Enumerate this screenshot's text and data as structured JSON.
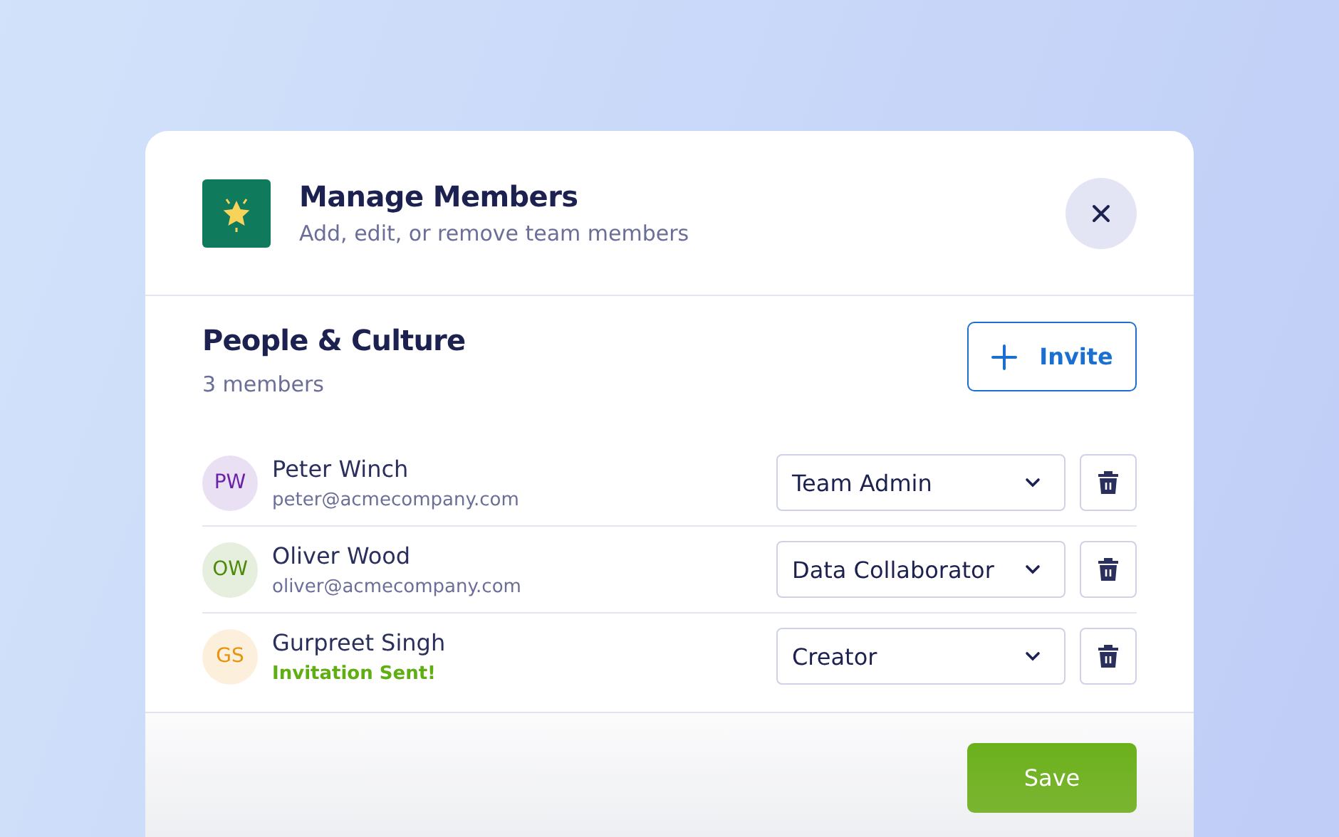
{
  "dialog": {
    "title": "Manage Members",
    "subtitle": "Add, edit, or remove team members"
  },
  "team": {
    "name": "People & Culture",
    "count": "3 members",
    "invite_button": "Invite"
  },
  "members": [
    {
      "initials": "PW",
      "color": "#6b21a8",
      "name": "Peter Winch",
      "kind": "email",
      "subtitle": "peter@acmecompany.com",
      "role": "Team Admin"
    },
    {
      "initials": "OW",
      "color": "#4d8a0c",
      "name": "Oliver Wood",
      "kind": "email",
      "subtitle": "oliver@acmecompany.com",
      "role": "Data Collaborator"
    },
    {
      "initials": "GS",
      "color": "#e8930c",
      "name": "Gurpreet Singh",
      "kind": "invited",
      "subtitle": "Invitation Sent!",
      "role": "Creator"
    }
  ],
  "footer": {
    "save_button": "Save"
  }
}
